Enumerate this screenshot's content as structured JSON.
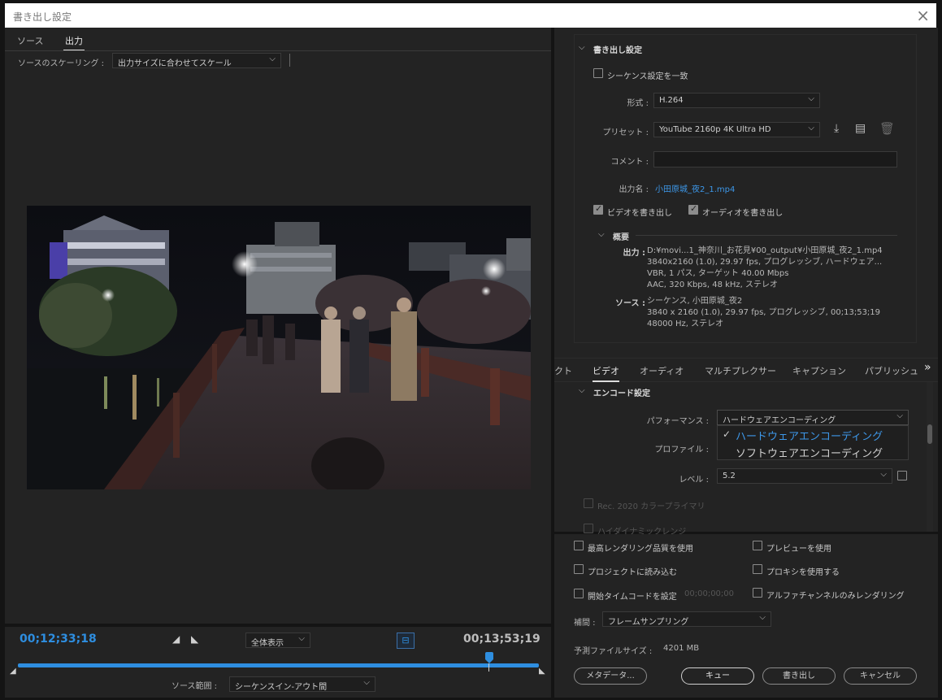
{
  "window": {
    "title": "書き出し設定",
    "close_icon": "×"
  },
  "left_panel": {
    "tabs": [
      "ソース",
      "出力"
    ],
    "active_tab": 1,
    "scaling_label": "ソースのスケーリング :",
    "scaling_value": "出力サイズに合わせてスケール"
  },
  "timeline": {
    "current_time": "00;12;33;18",
    "end_time": "00;13;53;19",
    "zoom_value": "全体表示",
    "source_range_label": "ソース範囲 :",
    "source_range_value": "シーケンスイン-アウト間",
    "playhead_fraction": 0.905,
    "accent_color": "#2e8ee0"
  },
  "export_settings": {
    "section_title": "書き出し設定",
    "match_sequence_label": "シーケンス設定を一致",
    "format_label": "形式 :",
    "format_value": "H.264",
    "preset_label": "プリセット :",
    "preset_value": "YouTube 2160p 4K Ultra HD",
    "comment_label": "コメント :",
    "comment_value": "",
    "output_name_label": "出力名 :",
    "output_name_value": "小田原城_夜2_1.mp4",
    "export_video_label": "ビデオを書き出し",
    "export_audio_label": "オーディオを書き出し",
    "summary_title": "概要",
    "output_label": "出力 :",
    "output_lines": [
      "D:¥movi...1_神奈川_お花見¥00_output¥小田原城_夜2_1.mp4",
      "3840x2160 (1.0), 29.97 fps, プログレッシブ, ハードウェア...",
      "VBR, 1 パス, ターゲット 40.00 Mbps",
      "AAC, 320 Kbps, 48 kHz, ステレオ"
    ],
    "source_label": "ソース :",
    "source_lines": [
      "シーケンス, 小田原城_夜2",
      "3840 x 2160 (1.0), 29.97 fps, プログレッシブ, 00;13;53;19",
      "48000 Hz, ステレオ"
    ]
  },
  "settings_tabs": {
    "items": [
      "クト",
      "ビデオ",
      "オーディオ",
      "マルチプレクサー",
      "キャプション",
      "パブリッシュ"
    ],
    "active_index": 1,
    "more_icon": "»"
  },
  "encode": {
    "section_title": "エンコード設定",
    "performance_label": "パフォーマンス :",
    "performance_value": "ハードウェアエンコーディング",
    "dropdown_options": [
      "ハードウェアエンコーディング",
      "ソフトウェアエンコーディング"
    ],
    "dropdown_selected": 0,
    "profile_label": "プロファイル :",
    "level_label": "レベル :",
    "level_value": "5.2",
    "rec2020_label": "Rec. 2020 カラープライマリ",
    "hdr_label": "ハイダイナミックレンジ"
  },
  "bottom": {
    "max_render_label": "最高レンダリング品質を使用",
    "use_preview_label": "プレビューを使用",
    "import_project_label": "プロジェクトに読み込む",
    "use_proxy_label": "プロキシを使用する",
    "start_timecode_label": "開始タイムコードを設定",
    "start_timecode_value": "00;00;00;00",
    "alpha_only_label": "アルファチャンネルのみレンダリング",
    "interp_label": "補間 :",
    "interp_value": "フレームサンプリング",
    "filesize_label": "予測ファイルサイズ :",
    "filesize_value": "4201 MB",
    "metadata_button": "メタデータ...",
    "queue_button": "キュー",
    "export_button": "書き出し",
    "cancel_button": "キャンセル"
  },
  "colors": {
    "link": "#3d97e8",
    "dropdown_selected": "#3d97e8"
  }
}
